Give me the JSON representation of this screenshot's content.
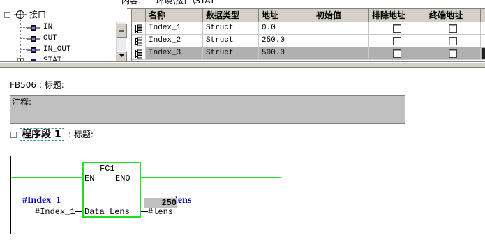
{
  "header": {
    "content_label": "内容:",
    "content_path": "'环境\\接口\\STAT'"
  },
  "tree": {
    "root": "接口",
    "items": [
      "IN",
      "OUT",
      "IN_OUT",
      "STAT"
    ]
  },
  "table": {
    "columns": [
      "名称",
      "数据类型",
      "地址",
      "初始值",
      "排除地址",
      "终端地址"
    ],
    "rows": [
      {
        "name": "Index_1",
        "type": "Struct",
        "address": "0.0",
        "exclude": false,
        "terminal": false
      },
      {
        "name": "Index_2",
        "type": "Struct",
        "address": "250.0",
        "exclude": false,
        "terminal": false
      },
      {
        "name": "Index_3",
        "type": "Struct",
        "address": "500.0",
        "exclude": false,
        "terminal": false
      }
    ],
    "selected_row": 2
  },
  "block": {
    "title": "FB506 : 标题:",
    "comment": "注释:"
  },
  "network": {
    "label": "程序段 1",
    "title": ": 标题:"
  },
  "ladder": {
    "block_name": "FC1",
    "en": "EN",
    "eno": "ENO",
    "input_pin": "Data",
    "output_pin": "Lens",
    "input_symbol": "#Index_1",
    "input_operand": "#Index_1",
    "output_symbol": "#lens",
    "output_operand": "#lens",
    "output_value": "250"
  },
  "icons": {
    "tree_collapse": "collapse-box-icon",
    "tree_expand": "expand-box-icon",
    "tree_root": "interface-icon",
    "tree_param": "parameter-icon",
    "row_type": "struct-icon",
    "scroll_down": "chevron-down-icon"
  },
  "colors": {
    "rung": "#1ee01e",
    "symbol": "#0000c8",
    "selection": "#b0b0b0",
    "status_box": "#c0c0c0",
    "comment_box": "#c0c0c0"
  }
}
